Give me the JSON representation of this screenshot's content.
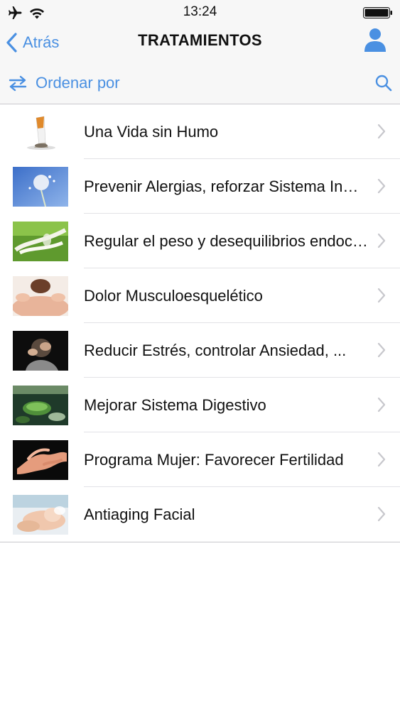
{
  "status_bar": {
    "time": "13:24",
    "icons": [
      "airplane-icon",
      "wifi-icon",
      "battery-icon"
    ]
  },
  "nav": {
    "back_label": "Atrás",
    "title": "TRATAMIENTOS",
    "profile_icon": "person-icon"
  },
  "toolbar": {
    "sort_label": "Ordenar por",
    "sort_icon": "swap-arrows-icon",
    "search_icon": "search-icon"
  },
  "colors": {
    "accent": "#4a90e2",
    "bar_background": "#f7f7f7",
    "separator": "#c8c7cc"
  },
  "treatments": [
    {
      "label": "Una Vida sin Humo",
      "thumb": "cigarette-photo"
    },
    {
      "label": "Prevenir Alergias, reforzar Sistema Inmunológico",
      "thumb": "dandelion-photo"
    },
    {
      "label": "Regular el peso y desequilibrios endocrinos",
      "thumb": "measuring-tape-photo"
    },
    {
      "label": "Dolor Musculoesquelético",
      "thumb": "back-massage-photo"
    },
    {
      "label": "Reducir Estrés, controlar Ansiedad, ...",
      "thumb": "stressed-person-photo"
    },
    {
      "label": "Mejorar Sistema Digestivo",
      "thumb": "green-tea-photo"
    },
    {
      "label": "Programa Mujer: Favorecer Fertilidad",
      "thumb": "hands-photo"
    },
    {
      "label": "Antiaging Facial",
      "thumb": "facial-treatment-photo"
    }
  ]
}
